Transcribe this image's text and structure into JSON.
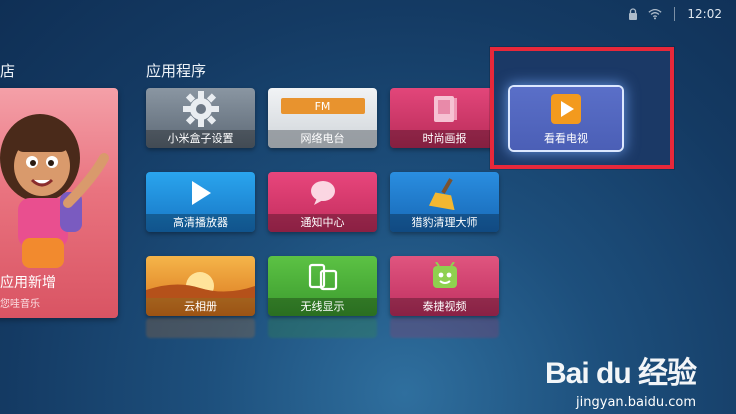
{
  "status": {
    "time": "12:02",
    "icons": [
      "lock-icon",
      "wifi-icon"
    ]
  },
  "store": {
    "title": "店",
    "caption": "应用新增",
    "subcaption": "您哇音乐"
  },
  "apps": {
    "title": "应用程序",
    "tiles": [
      {
        "label": "小米盒子设置",
        "icon": "gear-icon",
        "color": "#5f6b78"
      },
      {
        "label": "网络电台",
        "icon": "radio-icon",
        "color": "#dfe3e7",
        "badge": "FM"
      },
      {
        "label": "时尚画报",
        "icon": "magazine-icon",
        "color": "#c8345f"
      },
      {
        "label": "看看电视",
        "icon": "play-icon",
        "color": "#4b5fb6"
      },
      {
        "label": "高清播放器",
        "icon": "play-icon",
        "color": "#1e8fd8"
      },
      {
        "label": "通知中心",
        "icon": "chat-bubble-icon",
        "color": "#d53a6a"
      },
      {
        "label": "猎豹清理大师",
        "icon": "broom-icon",
        "color": "#1f7bc8"
      },
      {
        "label": "云相册",
        "icon": "sunset-icon",
        "color": "#e38c2a"
      },
      {
        "label": "无线显示",
        "icon": "devices-icon",
        "color": "#46a935"
      },
      {
        "label": "泰捷视频",
        "icon": "android-tv-icon",
        "color": "#c93a6a"
      }
    ]
  },
  "watermark": {
    "logo": "Bai du 经验",
    "url": "jingyan.baidu.com"
  },
  "colors": {
    "highlight": "#e8283a",
    "background": "#143a63"
  }
}
